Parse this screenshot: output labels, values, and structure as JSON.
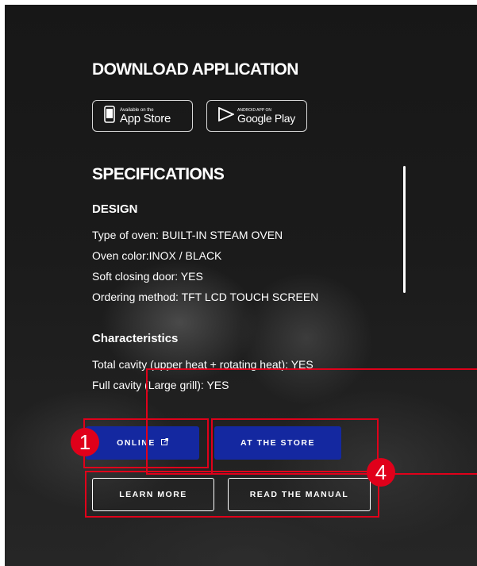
{
  "download": {
    "title": "DOWNLOAD APPLICATION",
    "app_store": {
      "small": "Available on the",
      "big": "App Store",
      "icon": "phone-icon"
    },
    "google_play": {
      "small": "ANDROID APP ON",
      "big": "Google Play",
      "icon": "play-icon"
    }
  },
  "specs": {
    "title": "SPECIFICATIONS",
    "design": {
      "heading": "DESIGN",
      "lines": [
        "Type of oven: BUILT-IN STEAM OVEN",
        "Oven color:INOX / BLACK",
        "Soft closing door: YES",
        "Ordering method: TFT LCD TOUCH SCREEN"
      ]
    },
    "characteristics": {
      "heading": "Characteristics",
      "lines": [
        "Total cavity (upper heat + rotating heat): YES",
        "Full cavity (Large grill): YES"
      ]
    }
  },
  "buttons": {
    "online": "ONLINE",
    "online_icon": "external-link-icon",
    "at_store": "AT THE STORE",
    "learn_more": "LEARN MORE",
    "read_manual": "READ THE MANUAL"
  },
  "annotations": {
    "one": "1",
    "four": "4",
    "color": "#e0001a"
  },
  "colors": {
    "accent_blue": "#1428a0",
    "background": "#1a1a1a"
  }
}
